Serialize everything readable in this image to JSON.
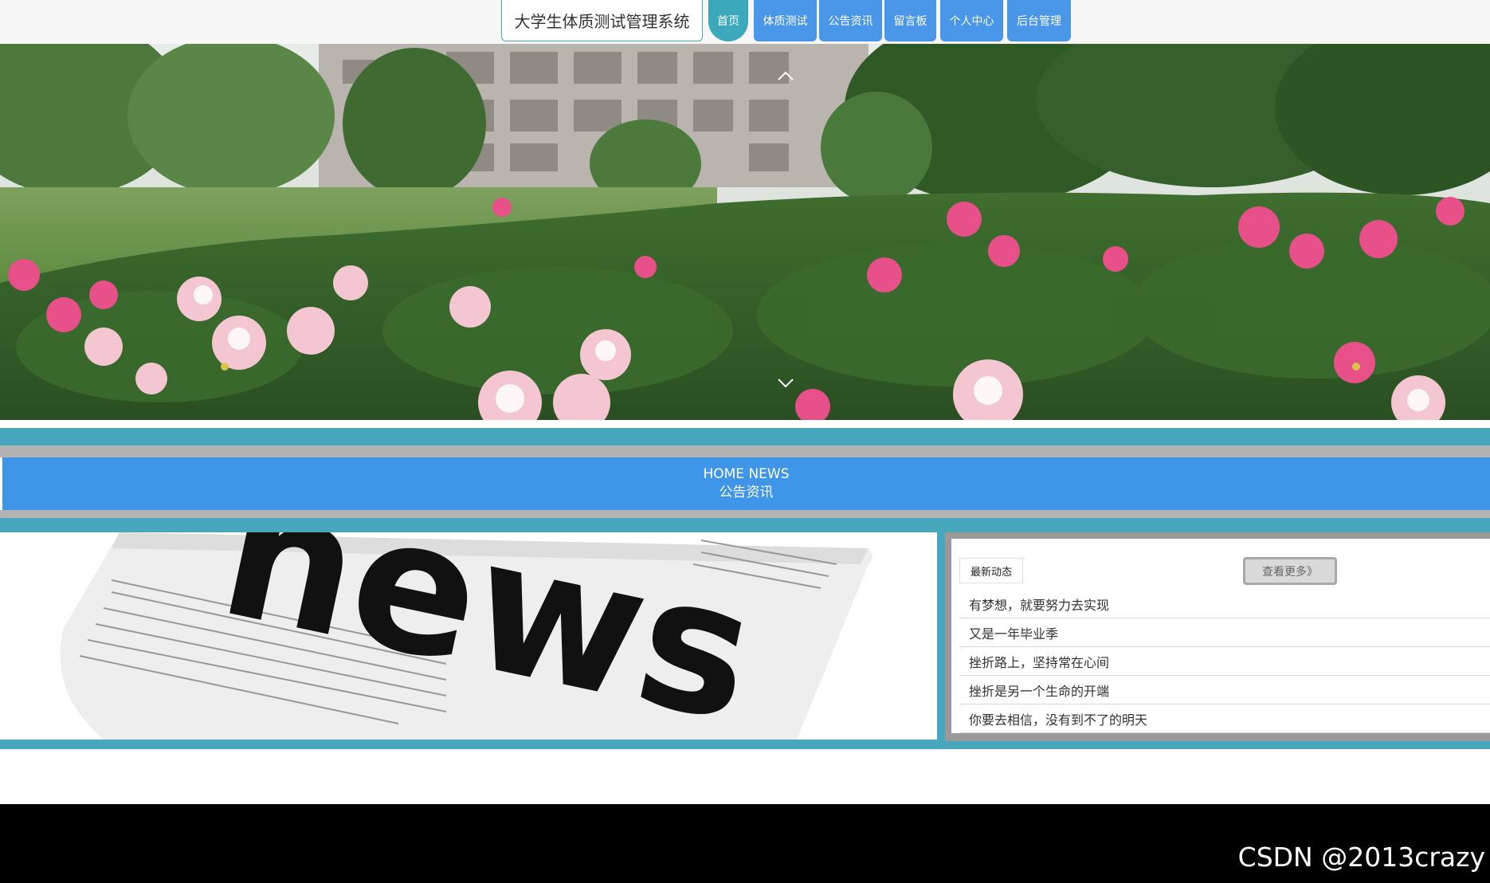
{
  "header": {
    "site_title": "大学生体质测试管理系统",
    "nav": [
      {
        "label": "首页",
        "active": true
      },
      {
        "label": "体质测试",
        "active": false
      },
      {
        "label": "公告资讯",
        "active": false
      },
      {
        "label": "留言板",
        "active": false
      },
      {
        "label": "个人中心",
        "active": false
      },
      {
        "label": "后台管理",
        "active": false
      }
    ]
  },
  "carousel": {
    "prev_icon": "chevron-up-icon",
    "next_icon": "chevron-down-icon"
  },
  "news_section": {
    "title_en": "HOME NEWS",
    "title_cn": "公告资讯",
    "image_word": "news",
    "tab_label": "最新动态",
    "more_label": "查看更多》",
    "items": [
      "有梦想，就要努力去实现",
      "又是一年毕业季",
      "挫折路上，坚持常在心间",
      "挫折是另一个生命的开端",
      "你要去相信，没有到不了的明天"
    ]
  },
  "watermark": "CSDN @2013crazy",
  "colors": {
    "teal": "#48a6bd",
    "nav_blue": "#4a96e8",
    "banner_blue": "#3f95e8",
    "footer": "#000000"
  }
}
